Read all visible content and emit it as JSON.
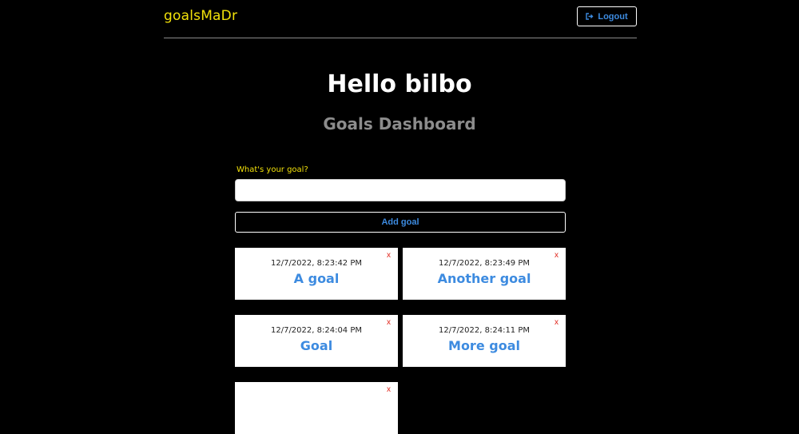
{
  "header": {
    "logo": "goalsMaDr",
    "logout_label": "Logout"
  },
  "main": {
    "greeting": "Hello bilbo",
    "subtitle": "Goals Dashboard"
  },
  "form": {
    "label": "What's your goal?",
    "input_value": "",
    "add_label": "Add goal"
  },
  "goals": [
    {
      "date": "12/7/2022, 8:23:42 PM",
      "text": "A goal",
      "close": "x"
    },
    {
      "date": "12/7/2022, 8:23:49 PM",
      "text": "Another goal",
      "close": "x"
    },
    {
      "date": "12/7/2022, 8:24:04 PM",
      "text": "Goal",
      "close": "x"
    },
    {
      "date": "12/7/2022, 8:24:11 PM",
      "text": "More goal",
      "close": "x"
    },
    {
      "date": "",
      "text": "",
      "close": "x"
    }
  ],
  "colors": {
    "accent": "#3d8be0",
    "logo": "#f2e10a",
    "close": "#e0251b"
  },
  "icons": {
    "logout": "sign-out-icon"
  }
}
